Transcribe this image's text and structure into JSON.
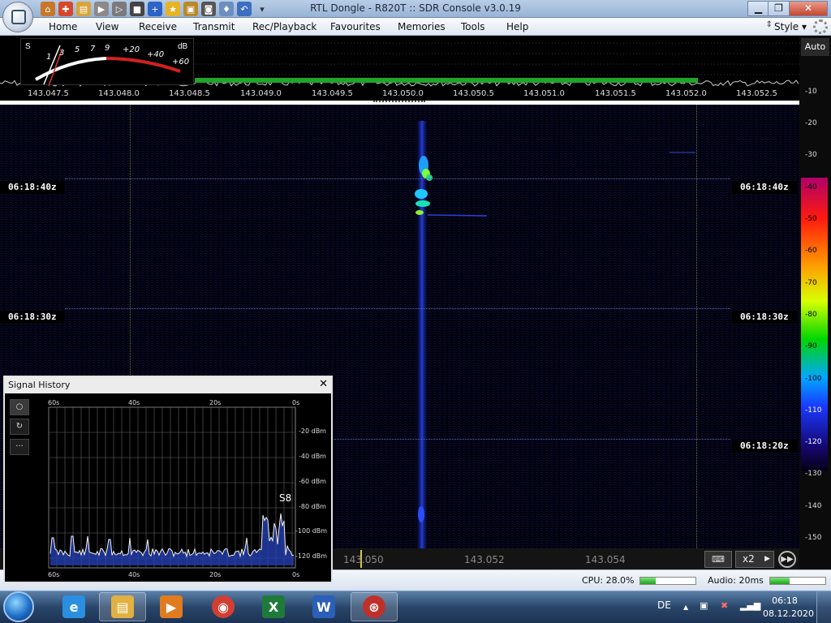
{
  "window": {
    "title": "RTL Dongle - R820T :: SDR Console v3.0.19",
    "minimize": "▁",
    "maximize": "❐",
    "close": "✕"
  },
  "menubar": {
    "items": [
      "Home",
      "View",
      "Receive",
      "Transmit",
      "Rec/Playback",
      "Favourites",
      "Memories",
      "Tools",
      "Help"
    ],
    "style_label": "Style",
    "style_arrow": "▾",
    "updown": "⇕"
  },
  "smeter": {
    "s_label": "S",
    "db_label": "dB",
    "scale_white": [
      "1",
      "3",
      "5",
      "7",
      "9"
    ],
    "scale_red": [
      "+20",
      "+40",
      "+60"
    ]
  },
  "frequency_axis": [
    "143.047.5",
    "143.048.0",
    "143.048.5",
    "143.049.0",
    "143.049.5",
    "143.050.0",
    "143.050.5",
    "143.051.0",
    "143.051.5",
    "143.052.0",
    "143.052.5"
  ],
  "right_scale": {
    "auto_label": "Auto",
    "ticks": [
      "-10",
      "-20",
      "-30",
      "-40",
      "-50",
      "-60",
      "-70",
      "-80",
      "-90",
      "-100",
      "-110",
      "-120",
      "-130",
      "-140",
      "-150"
    ]
  },
  "waterfall": {
    "time_markers": [
      {
        "label": "06:18:40z",
        "side": "both"
      },
      {
        "label": "06:18:30z",
        "side": "both"
      },
      {
        "label": "06:18:20z",
        "side": "right"
      }
    ]
  },
  "bottom_strip": {
    "freqs": [
      "143.050",
      "143.052",
      "143.054"
    ],
    "keyboard_icon": "⌨",
    "zoom_label": "x2",
    "zoom_arrow": "▶",
    "play_icon": "▶▶"
  },
  "status": {
    "cpu_label": "CPU: 28.0%",
    "cpu_value": 0.28,
    "audio_label": "Audio: 20ms",
    "audio_value": 0.35
  },
  "signal_history": {
    "title": "Signal History",
    "close": "✕",
    "side_buttons": [
      "○",
      "↻",
      "···"
    ],
    "top_time_labels": [
      "60s",
      "40s",
      "20s",
      "0s"
    ],
    "bottom_time_labels": [
      "60s",
      "40s",
      "20s",
      "0s"
    ],
    "dbm_labels": [
      "-20 dBm",
      "-40 dBm",
      "-60 dBm",
      "-80 dBm",
      "-100 dBm",
      "-120 dBm"
    ],
    "peak_label": "S8"
  },
  "taskbar": {
    "apps": [
      {
        "name": "internet-explorer",
        "glyph": "e",
        "color": "#2a8fe0"
      },
      {
        "name": "windows-explorer",
        "glyph": "▤",
        "color": "#e0b040"
      },
      {
        "name": "media-player",
        "glyph": "▶",
        "color": "#e07b20"
      },
      {
        "name": "chrome",
        "glyph": "◉",
        "color": "#d23f31"
      },
      {
        "name": "excel",
        "glyph": "X",
        "color": "#1f7a3a"
      },
      {
        "name": "word",
        "glyph": "W",
        "color": "#2b5fb8"
      },
      {
        "name": "sdr-console",
        "glyph": "⊛",
        "color": "#c0302a"
      }
    ],
    "language": "DE",
    "tray_up": "▲",
    "clock_time": "06:18",
    "clock_date": "08.12.2020"
  },
  "colors": {
    "accent_green": "#1fa52a",
    "waterfall_bg": "#02020a",
    "titlebar": "#98b3d6"
  }
}
